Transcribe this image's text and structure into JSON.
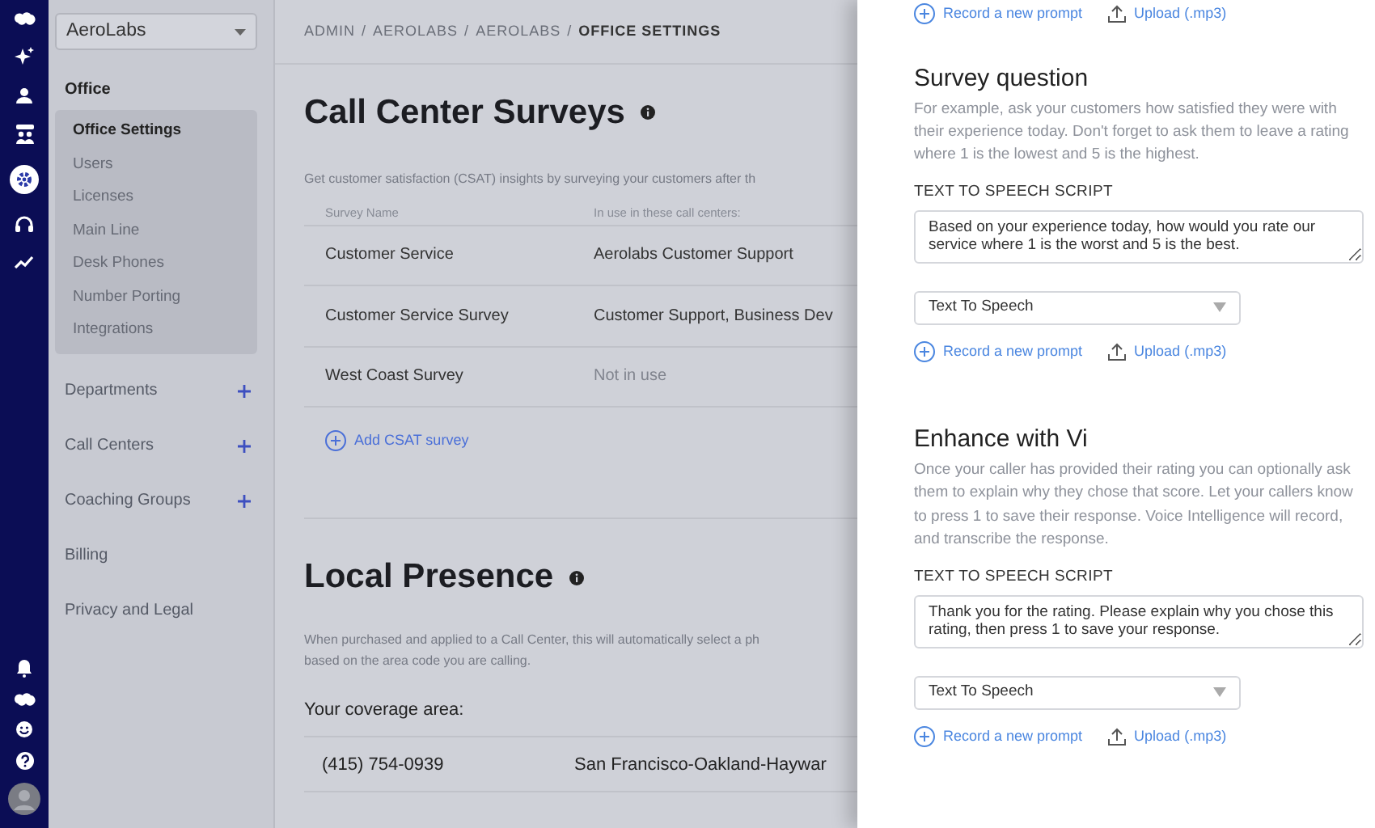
{
  "rail": {
    "top_icons": [
      {
        "kind": "logo",
        "selected": false
      },
      {
        "kind": "sparkle",
        "selected": false
      },
      {
        "kind": "person",
        "selected": false
      },
      {
        "kind": "team",
        "selected": false
      },
      {
        "kind": "gear",
        "selected": true
      },
      {
        "kind": "headset",
        "selected": false
      },
      {
        "kind": "trend",
        "selected": false
      }
    ],
    "bottom_icons": [
      {
        "kind": "bell",
        "selected": false
      },
      {
        "kind": "logo",
        "selected": false
      },
      {
        "kind": "smiley",
        "selected": false
      },
      {
        "kind": "help",
        "selected": false
      },
      {
        "kind": "avatar",
        "selected": false
      }
    ]
  },
  "sidebar": {
    "org_select": {
      "value": "AeroLabs"
    },
    "sections": [
      {
        "label": "Office",
        "expanded": true,
        "add_button": false,
        "children": [
          {
            "label": "Office Settings",
            "selected": true
          },
          {
            "label": "Users",
            "selected": false
          },
          {
            "label": "Licenses",
            "selected": false
          },
          {
            "label": "Main Line",
            "selected": false
          },
          {
            "label": "Desk Phones",
            "selected": false
          },
          {
            "label": "Number Porting",
            "selected": false
          },
          {
            "label": "Integrations",
            "selected": false
          }
        ]
      },
      {
        "label": "Departments",
        "expanded": false,
        "add_button": true
      },
      {
        "label": "Call Centers",
        "expanded": false,
        "add_button": true
      },
      {
        "label": "Coaching Groups",
        "expanded": false,
        "add_button": true
      },
      {
        "label": "Billing",
        "expanded": false,
        "add_button": false
      },
      {
        "label": "Privacy and Legal",
        "expanded": false,
        "add_button": false
      }
    ]
  },
  "breadcrumb": [
    {
      "kind": "link",
      "label": "ADMIN",
      "current": false
    },
    {
      "kind": "separator",
      "label": "/"
    },
    {
      "kind": "link",
      "label": "AEROLABS",
      "current": false
    },
    {
      "kind": "separator",
      "label": "/"
    },
    {
      "kind": "link",
      "label": "AEROLABS",
      "current": false
    },
    {
      "kind": "separator",
      "label": "/"
    },
    {
      "kind": "link",
      "label": "OFFICE SETTINGS",
      "current": true
    }
  ],
  "csat": {
    "title": "Call Center Surveys",
    "description": "Get customer satisfaction (CSAT) insights by surveying your customers after th",
    "table": {
      "columns": [
        "Survey Name",
        "In use in these call centers:"
      ],
      "rows": [
        {
          "cells": [
            "Customer Service",
            "Aerolabs Customer Support"
          ],
          "in_use": true
        },
        {
          "cells": [
            "Customer Service Survey",
            "Customer Support, Business Dev"
          ],
          "in_use": true
        },
        {
          "cells": [
            "West Coast Survey",
            "Not in use"
          ],
          "in_use": false
        }
      ]
    },
    "add_label": "Add CSAT survey"
  },
  "local_presence": {
    "title": "Local Presence",
    "description_lines": [
      "When purchased and applied to a Call Center, this will automatically select a ph",
      "based on the area code you are calling."
    ],
    "coverage_label": "Your coverage area:",
    "rows": [
      {
        "number": "(415) 754-0939",
        "area": "San Francisco-Oakland-Haywar"
      }
    ]
  },
  "panel": {
    "top_actions": {
      "record_label": "Record a new prompt",
      "upload_label": "Upload (.mp3)"
    },
    "sections": [
      {
        "title": "Survey question",
        "description": "For example, ask your customers how satisfied they were with their experience today. Don't forget to ask them to leave a rating where 1 is the lowest and 5 is the highest.",
        "script_label": "TEXT TO SPEECH SCRIPT",
        "script": "Based on your experience today, how would you rate our service where 1 is the worst and 5 is the best.",
        "select_value": "Text To Speech",
        "record_label": "Record a new prompt",
        "upload_label": "Upload (.mp3)"
      },
      {
        "title": "Enhance with Vi",
        "description": "Once your caller has provided their rating you can optionally ask them to explain why they chose that score. Let your callers know to press 1 to save their response. Voice Intelligence will record, and transcribe the response.",
        "script_label": "TEXT TO SPEECH SCRIPT",
        "script": "Thank you for the rating. Please explain why you chose this rating, then press 1 to save your response.",
        "select_value": "Text To Speech",
        "record_label": "Record a new prompt",
        "upload_label": "Upload (.mp3)"
      }
    ]
  }
}
